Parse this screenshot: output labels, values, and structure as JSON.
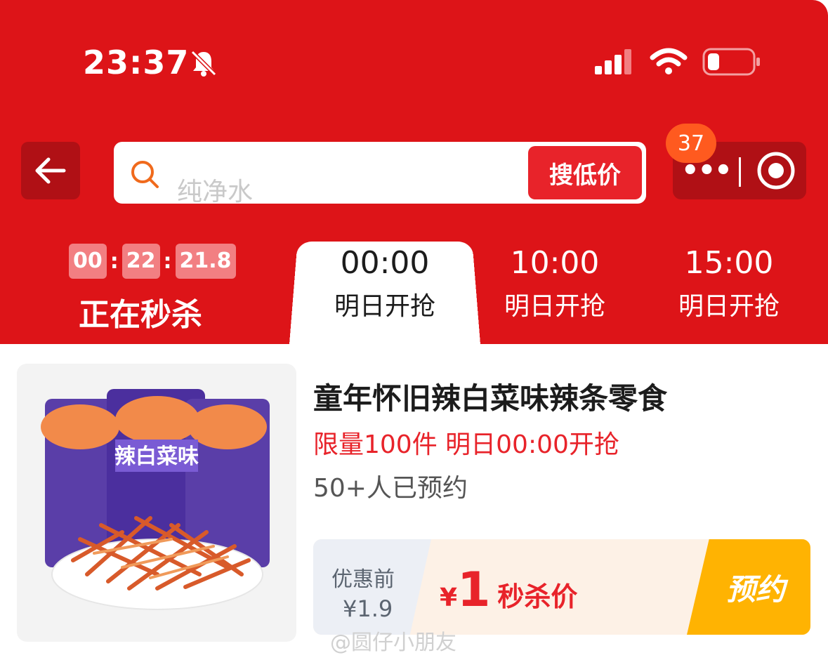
{
  "status_bar": {
    "time": "23:37"
  },
  "header": {
    "search_placeholder": "纯净水",
    "search_button": "搜低价",
    "badge_count": "37",
    "capsule_more": "•••"
  },
  "tabs": {
    "countdown": [
      "00",
      "22",
      "21.8"
    ],
    "live_label": "正在秒杀",
    "items": [
      {
        "time": "00:00",
        "sub": "明日开抢",
        "active": true
      },
      {
        "time": "10:00",
        "sub": "明日开抢",
        "active": false
      },
      {
        "time": "15:00",
        "sub": "明日开抢",
        "active": false
      }
    ]
  },
  "product": {
    "title": "童年怀旧辣白菜味辣条零食",
    "limit_text": "限量100件 明日00:00开抢",
    "reserved_text": "50+人已预约",
    "original_label": "优惠前",
    "original_price": "¥1.9",
    "flash_yen": "¥",
    "flash_price": "1",
    "flash_label": "秒杀价",
    "reserve_button": "预约",
    "package_text": "辣白菜味"
  },
  "watermark": "@圆仔小朋友",
  "colors": {
    "header_red": "#dd1418",
    "accent_red": "#e8232a",
    "badge_orange": "#ff5a1f",
    "reserve_yellow": "#ffb302"
  }
}
